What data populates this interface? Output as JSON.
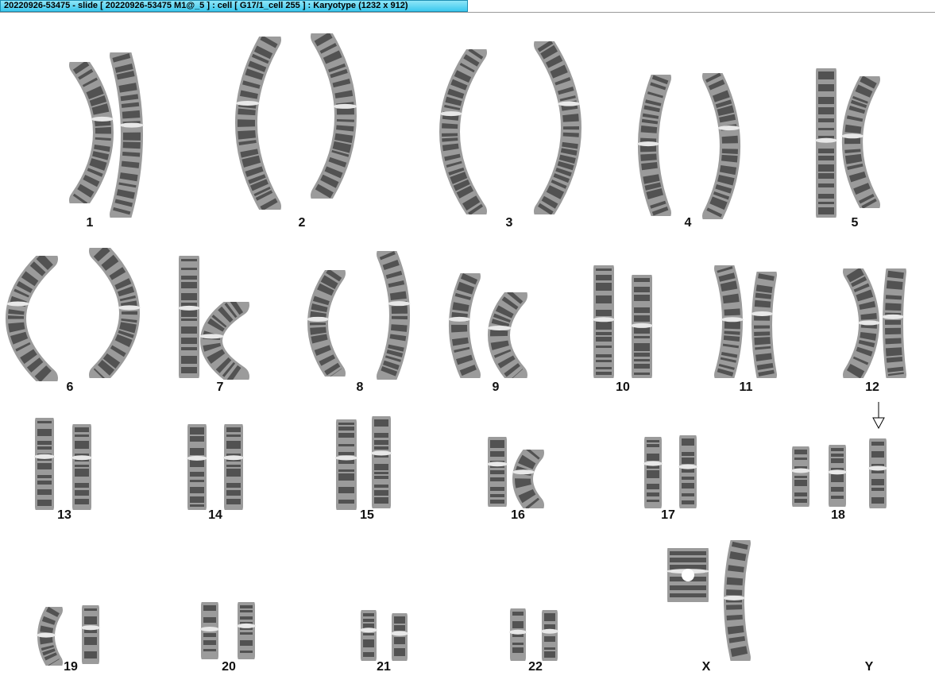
{
  "window": {
    "title": "20220926-53475 - slide [ 20220926-53475 M1@_5 ] : cell [ G17/1_cell 255 ] : Karyotype  (1232 x 912)"
  },
  "karyotype": {
    "labels": [
      "1",
      "2",
      "3",
      "4",
      "5",
      "6",
      "7",
      "8",
      "9",
      "10",
      "11",
      "12",
      "13",
      "14",
      "15",
      "16",
      "17",
      "18",
      "19",
      "20",
      "21",
      "22",
      "X",
      "Y"
    ],
    "chromosome_counts": [
      2,
      2,
      2,
      2,
      2,
      2,
      2,
      2,
      2,
      2,
      2,
      2,
      2,
      2,
      2,
      2,
      2,
      3,
      2,
      2,
      2,
      2,
      2,
      0
    ],
    "marked_chromosome": "18",
    "marker_icon": "down-arrow-icon"
  }
}
